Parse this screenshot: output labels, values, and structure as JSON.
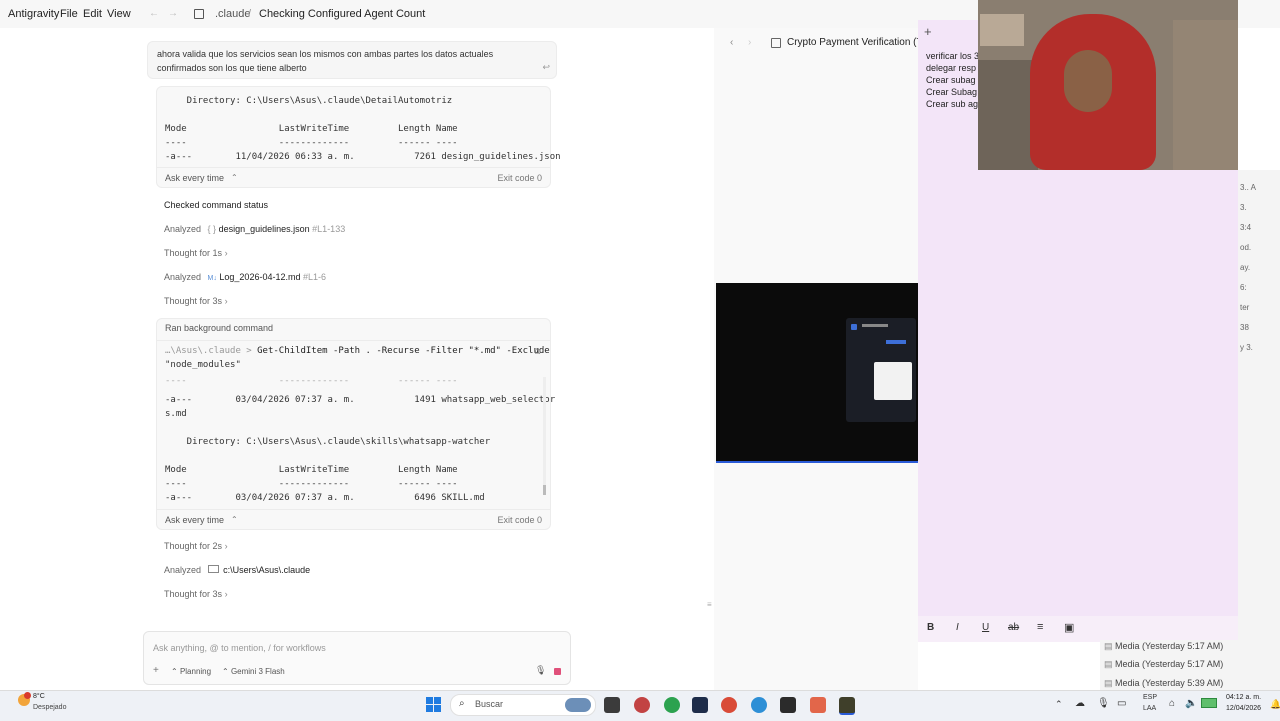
{
  "menubar": {
    "app": "Antigravity",
    "file": "File",
    "edit": "Edit",
    "view": "View",
    "breadcrumb_root": ".claude",
    "breadcrumb_title": "Checking Configured Agent Count"
  },
  "chat": {
    "user_message": "ahora valida que los servicios sean los mismos con ambas partes los datos actuales confirmados son los que tiene alberto",
    "block1": {
      "directory": "    Directory: C:\\Users\\Asus\\.claude\\DetailAutomotriz",
      "header": "Mode                 LastWriteTime         Length Name",
      "divider": "----                 -------------         ------ ----",
      "row": "-a---        11/04/2026 06:33 a. m.           7261 design_guidelines.json",
      "ask": "Ask every time",
      "exit": "Exit code 0"
    },
    "steps1": [
      {
        "prefix": "Checked command status",
        "name": "",
        "range": ""
      },
      {
        "prefix": "Analyzed",
        "name": "design_guidelines.json",
        "range": "#L1-133"
      },
      {
        "prefix": "Thought for 1s",
        "name": "",
        "range": ""
      },
      {
        "prefix": "Analyzed",
        "name": "Log_2026-04-12.md",
        "range": "#L1-6"
      },
      {
        "prefix": "Thought for 3s",
        "name": "",
        "range": ""
      }
    ],
    "block2": {
      "title": "Ran background command",
      "cmd_path": "…\\Asus\\.claude",
      "cmd_prompt": ">",
      "command": "Get-ChildItem -Path . -Recurse -Filter \"*.md\" -Exclude",
      "command2": "\"node_modules\"",
      "line_a": "----                 -------------         ------ ----",
      "line_b": "-a---        03/04/2026 07:37 a. m.           1491 whatsapp_web_selector",
      "line_c": "s.md",
      "directory": "    Directory: C:\\Users\\Asus\\.claude\\skills\\whatsapp-watcher",
      "header": "Mode                 LastWriteTime         Length Name",
      "divider": "----                 -------------         ------ ----",
      "row": "-a---        03/04/2026 07:37 a. m.           6496 SKILL.md",
      "ask": "Ask every time",
      "exit": "Exit code 0"
    },
    "steps2": [
      {
        "prefix": "Thought for 2s",
        "name": ""
      },
      {
        "prefix": "Analyzed",
        "name": "c:\\Users\\Asus\\.claude"
      },
      {
        "prefix": "Thought for 3s",
        "name": ""
      }
    ],
    "input_placeholder": "Ask anything, @ to mention, / for workflows",
    "mode": "Planning",
    "model": "Gemini 3 Flash"
  },
  "right_pane": {
    "title": "Crypto Payment Verification (Te"
  },
  "notes": {
    "lines": [
      "verificar los 3",
      "delegar resp",
      "Crear subag",
      "Crear Subag",
      "Crear sub ag"
    ],
    "right_edge": [
      "3.. A",
      "3.",
      "3:4",
      "od.",
      "ay.",
      "6:",
      "ter",
      "38",
      "y 3."
    ],
    "toolbar": [
      "B",
      "I",
      "U",
      "ab",
      "≡",
      "▣"
    ]
  },
  "media": [
    "Media (Yesterday 5:17 AM)",
    "Media (Yesterday 5:17 AM)",
    "Media (Yesterday 5:39 AM)"
  ],
  "taskbar": {
    "weather_temp": "8°C",
    "weather_desc": "Despejado",
    "search": "Buscar",
    "lang1": "ESP",
    "lang2": "LAA",
    "time": "04:12 a. m.",
    "date": "12/04/2026"
  }
}
